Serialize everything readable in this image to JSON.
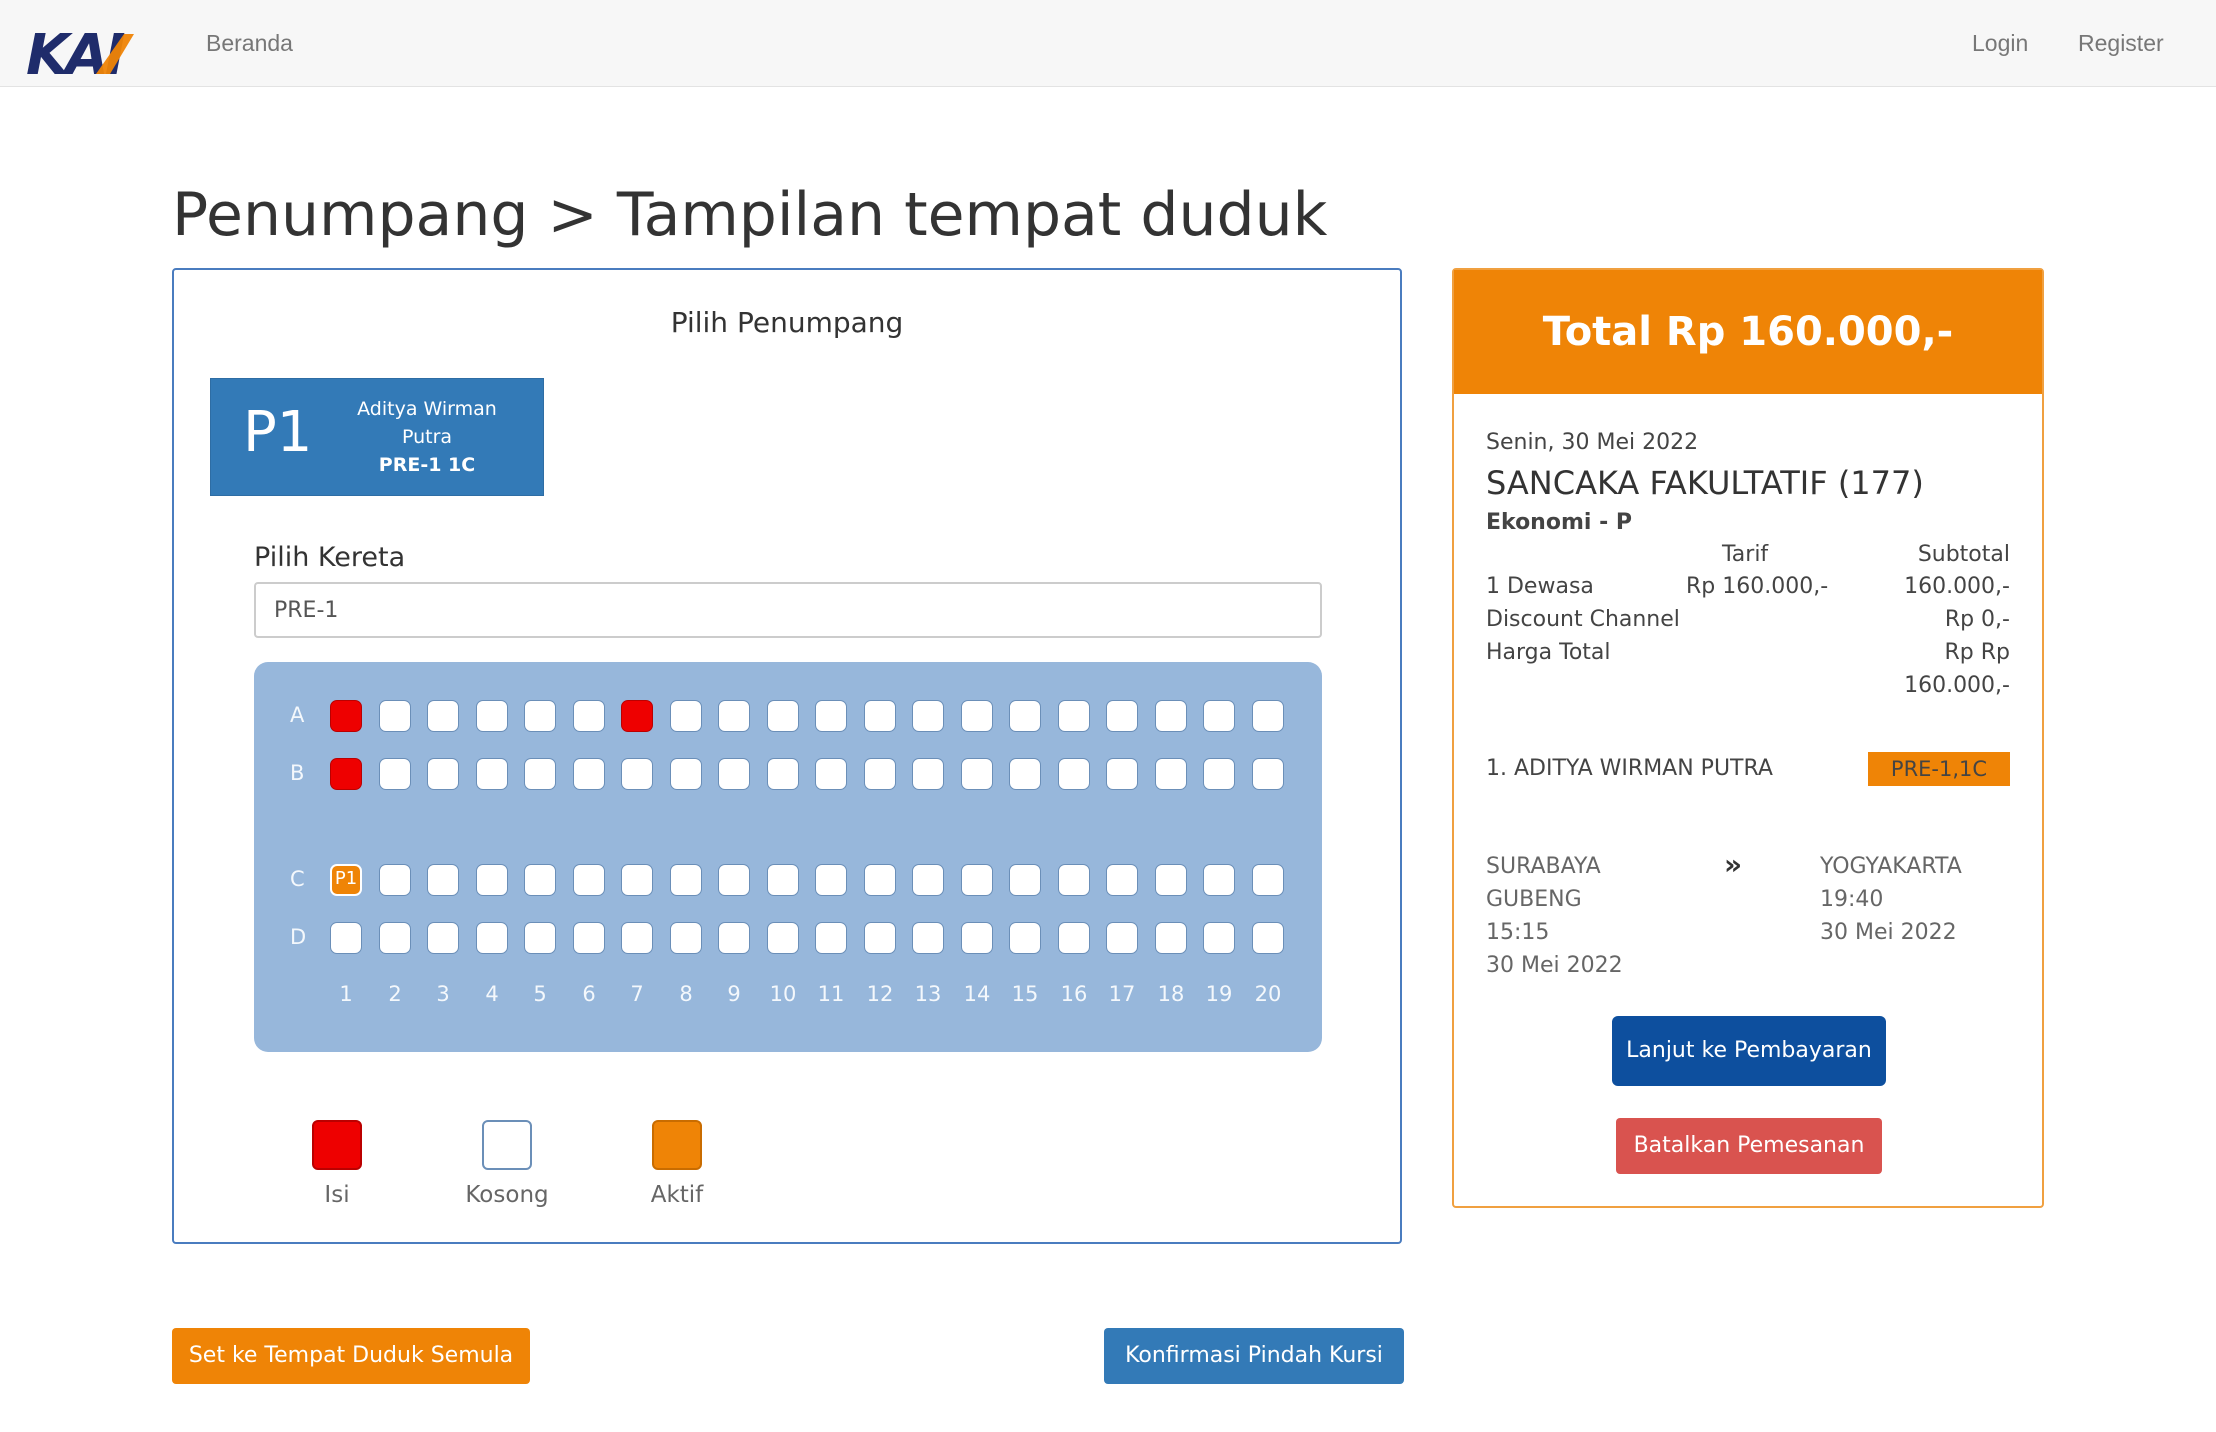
{
  "nav": {
    "logo_text": "KAI",
    "home": "Beranda",
    "login": "Login",
    "register": "Register"
  },
  "page": {
    "title": "Penumpang > Tampilan tempat duduk"
  },
  "passenger_panel": {
    "title": "Pilih Penumpang",
    "passenger": {
      "code": "P1",
      "name_line1": "Aditya Wirman",
      "name_line2": "Putra",
      "seat": "PRE-1 1C"
    },
    "train_label": "Pilih Kereta",
    "train_value": "PRE-1"
  },
  "seatmap": {
    "rows": [
      "A",
      "B",
      "C",
      "D"
    ],
    "columns": [
      "1",
      "2",
      "3",
      "4",
      "5",
      "6",
      "7",
      "8",
      "9",
      "10",
      "11",
      "12",
      "13",
      "14",
      "15",
      "16",
      "17",
      "18",
      "19",
      "20"
    ],
    "filled": [
      "A1",
      "A7",
      "B1"
    ],
    "active": [
      {
        "seat": "C1",
        "label": "P1"
      }
    ]
  },
  "legend": {
    "filled": "Isi",
    "empty": "Kosong",
    "active": "Aktif"
  },
  "actions": {
    "reset": "Set ke Tempat Duduk Semula",
    "confirm": "Konfirmasi Pindah Kursi"
  },
  "summary": {
    "total": "Total Rp 160.000,-",
    "date": "Senin, 30 Mei 2022",
    "train_name": "SANCAKA FAKULTATIF (177)",
    "class": "Ekonomi - P",
    "col_tarif": "Tarif",
    "col_subtotal": "Subtotal",
    "lines": [
      {
        "label": "1 Dewasa",
        "tarif": "Rp 160.000,-",
        "subtotal": "160.000,-"
      },
      {
        "label": "Discount Channel",
        "tarif": "",
        "subtotal": "Rp 0,-"
      },
      {
        "label": "Harga Total",
        "tarif": "",
        "subtotal": "Rp Rp"
      }
    ],
    "total_extra": "160.000,-",
    "passenger_name": "1. ADITYA WIRMAN PUTRA",
    "passenger_seat": "PRE-1,1C",
    "origin": {
      "line1": "SURABAYA",
      "line2": "GUBENG",
      "time": "15:15",
      "date": "30 Mei 2022"
    },
    "arrow": "»",
    "destination": {
      "city": "YOGYAKARTA",
      "time": "19:40",
      "date": "30 Mei 2022"
    },
    "pay_button": "Lanjut ke Pembayaran",
    "cancel_button": "Batalkan Pemesanan"
  },
  "colors": {
    "primary": "#337ab7",
    "accent": "#ef8406",
    "filled": "#ee0000",
    "danger": "#d9534f",
    "dark_blue": "#0d4f9e",
    "seatmap_bg": "#97b7db"
  }
}
